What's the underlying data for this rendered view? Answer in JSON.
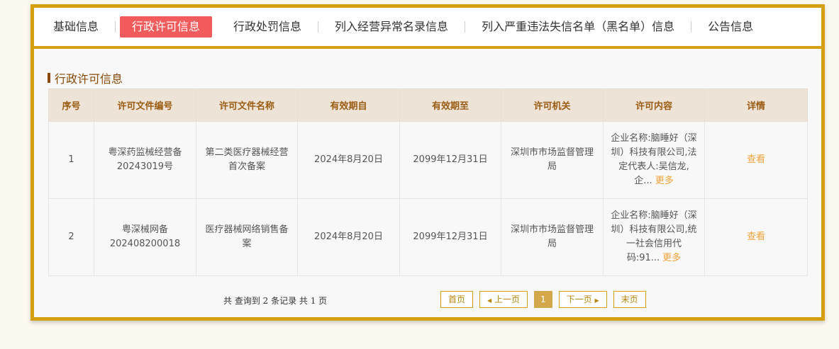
{
  "tabs": [
    {
      "label": "基础信息"
    },
    {
      "label": "行政许可信息"
    },
    {
      "label": "行政处罚信息"
    },
    {
      "label": "列入经营异常名录信息"
    },
    {
      "label": "列入严重违法失信名单（黑名单）信息"
    },
    {
      "label": "公告信息"
    }
  ],
  "section_title": "行政许可信息",
  "table": {
    "headers": [
      "序号",
      "许可文件编号",
      "许可文件名称",
      "有效期自",
      "有效期至",
      "许可机关",
      "许可内容",
      "详情"
    ],
    "rows": [
      {
        "index": "1",
        "doc_no": "粤深药监械经营备20243019号",
        "doc_name": "第二类医疗器械经营首次备案",
        "valid_from": "2024年8月20日",
        "valid_to": "2099年12月31日",
        "authority": "深圳市市场监督管理局",
        "content": "企业名称:脑睡好（深圳）科技有限公司,法定代表人:吴信龙,企...",
        "more": "更多",
        "detail": "查看"
      },
      {
        "index": "2",
        "doc_no": "粤深械网备202408200018",
        "doc_name": "医疗器械网络销售备案",
        "valid_from": "2024年8月20日",
        "valid_to": "2099年12月31日",
        "authority": "深圳市市场监督管理局",
        "content": "企业名称:脑睡好（深圳）科技有限公司,统一社会信用代码:91...",
        "more": "更多",
        "detail": "查看"
      }
    ]
  },
  "pagination": {
    "summary": "共 查询到 2 条记录 共 1 页",
    "first": "首页",
    "prev": "上一页",
    "current": "1",
    "next": "下一页",
    "last": "末页"
  },
  "colors": {
    "frame": "#d4a00f",
    "active_tab": "#f25b5b",
    "section_title": "#8a4a06",
    "link": "#f2a23a"
  }
}
